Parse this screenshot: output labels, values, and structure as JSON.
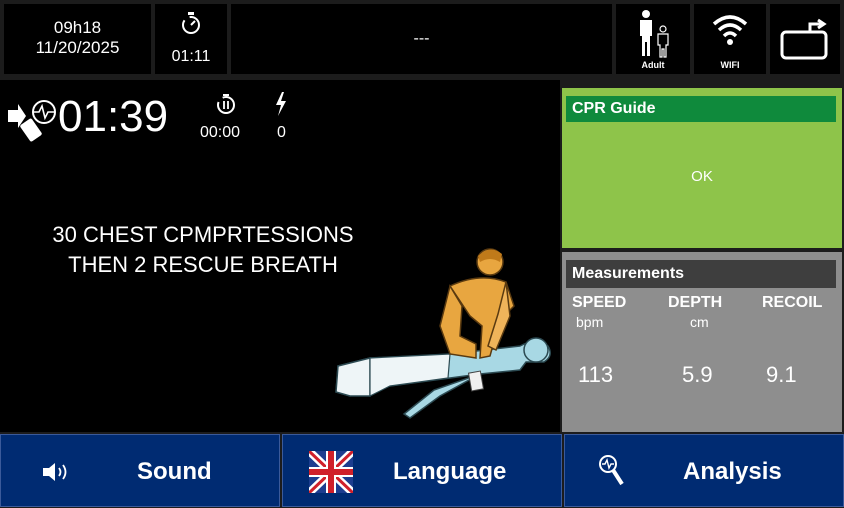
{
  "status_bar": {
    "time": "09h18",
    "date": "11/20/2025",
    "elapsed": "01:11",
    "message": "---",
    "patient_mode": "Adult",
    "network": "WIFI"
  },
  "therapy": {
    "time": "01:39",
    "pause_time": "00:00",
    "shock_count": "0"
  },
  "instruction": {
    "line1": "30 CHEST CPMPRTESSIONS",
    "line2": "THEN 2 RESCUE BREATH"
  },
  "cpr_guide": {
    "title": "CPR Guide",
    "status": "OK",
    "color": "#8ec44a"
  },
  "measurements": {
    "title": "Measurements",
    "speed": {
      "label": "SPEED",
      "unit": "bpm",
      "value": "113"
    },
    "depth": {
      "label": "DEPTH",
      "unit": "cm",
      "value": "5.9"
    },
    "recoil": {
      "label": "RECOIL",
      "unit": "",
      "value": "9.1"
    }
  },
  "buttons": {
    "sound": "Sound",
    "language": "Language",
    "analysis": "Analysis"
  },
  "icons": [
    "stopwatch-icon",
    "adult-child-icon",
    "wifi-icon",
    "battery-icon",
    "heart-electrode-icon",
    "pause-icon",
    "shock-icon",
    "speaker-icon",
    "uk-flag-icon",
    "magnifier-icon"
  ]
}
